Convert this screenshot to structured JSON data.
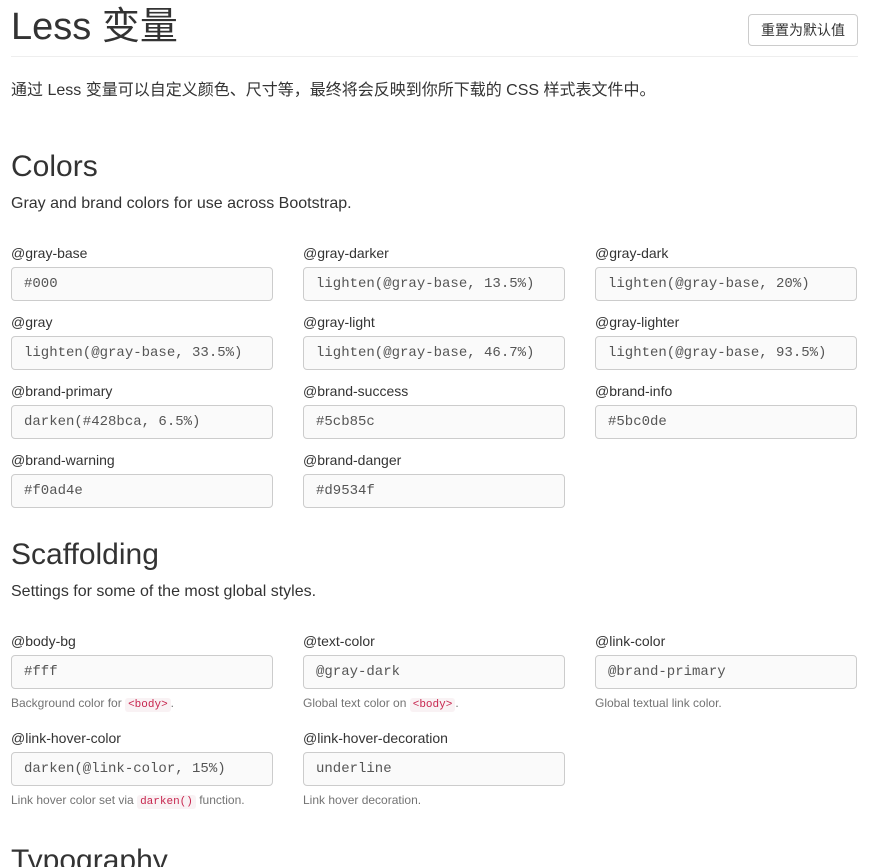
{
  "header": {
    "title": "Less 变量",
    "reset_label": "重置为默认值"
  },
  "lead": "通过 Less 变量可以自定义颜色、尺寸等，最终将会反映到你所下载的 CSS 样式表文件中。",
  "colors": {
    "title": "Colors",
    "description": "Gray and brand colors for use across Bootstrap.",
    "vars": [
      {
        "name": "@gray-base",
        "value": "#000"
      },
      {
        "name": "@gray-darker",
        "value": "lighten(@gray-base, 13.5%)"
      },
      {
        "name": "@gray-dark",
        "value": "lighten(@gray-base, 20%)"
      },
      {
        "name": "@gray",
        "value": "lighten(@gray-base, 33.5%)"
      },
      {
        "name": "@gray-light",
        "value": "lighten(@gray-base, 46.7%)"
      },
      {
        "name": "@gray-lighter",
        "value": "lighten(@gray-base, 93.5%)"
      },
      {
        "name": "@brand-primary",
        "value": "darken(#428bca, 6.5%)"
      },
      {
        "name": "@brand-success",
        "value": "#5cb85c"
      },
      {
        "name": "@brand-info",
        "value": "#5bc0de"
      },
      {
        "name": "@brand-warning",
        "value": "#f0ad4e"
      },
      {
        "name": "@brand-danger",
        "value": "#d9534f"
      }
    ]
  },
  "scaffolding": {
    "title": "Scaffolding",
    "description": "Settings for some of the most global styles.",
    "vars": [
      {
        "name": "@body-bg",
        "value": "#fff",
        "help_before": "Background color for ",
        "help_code": "<body>",
        "help_after": "."
      },
      {
        "name": "@text-color",
        "value": "@gray-dark",
        "help_before": "Global text color on ",
        "help_code": "<body>",
        "help_after": "."
      },
      {
        "name": "@link-color",
        "value": "@brand-primary",
        "help_before": "Global textual link color.",
        "help_code": "",
        "help_after": ""
      },
      {
        "name": "@link-hover-color",
        "value": "darken(@link-color, 15%)",
        "help_before": "Link hover color set via ",
        "help_code": "darken()",
        "help_after": " function."
      },
      {
        "name": "@link-hover-decoration",
        "value": "underline",
        "help_before": "Link hover decoration.",
        "help_code": "",
        "help_after": ""
      }
    ]
  },
  "typography": {
    "title": "Typography"
  }
}
